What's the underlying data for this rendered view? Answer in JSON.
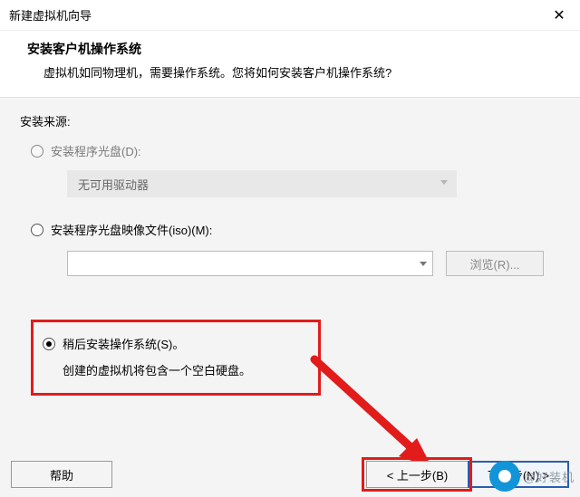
{
  "window": {
    "title": "新建虚拟机向导",
    "close_glyph": "✕"
  },
  "header": {
    "heading": "安装客户机操作系统",
    "subheading": "虚拟机如同物理机，需要操作系统。您将如何安装客户机操作系统?"
  },
  "source_label": "安装来源:",
  "options": {
    "disc": {
      "label": "安装程序光盘(D):"
    },
    "disc_dropdown": {
      "text": "无可用驱动器"
    },
    "iso": {
      "label": "安装程序光盘映像文件(iso)(M):"
    },
    "browse_label": "浏览(R)...",
    "later": {
      "label": "稍后安装操作系统(S)。"
    },
    "later_note": "创建的虚拟机将包含一个空白硬盘。"
  },
  "footer": {
    "help": "帮助",
    "back": "< 上一步(B)",
    "next": "下一步(N) >"
  },
  "watermark": "@好装机"
}
